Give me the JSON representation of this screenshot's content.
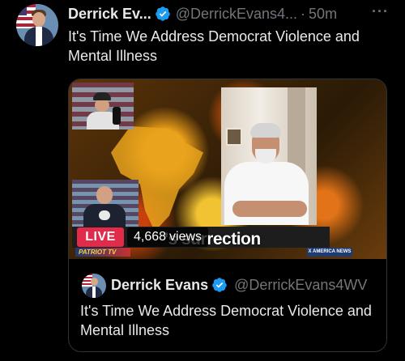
{
  "tweet": {
    "display_name": "Derrick Ev...",
    "handle": "@DerrickEvans4...",
    "separator": "·",
    "time": "50m",
    "more_label": "···",
    "text": "It's Time We Address Democrat Violence and Mental Illness"
  },
  "quote": {
    "display_name": "Derrick Evans",
    "handle": "@DerrickEvans4WV",
    "text": "It's Time We Address Democrat Violence and Mental Illness",
    "media": {
      "live_label": "LIVE",
      "views_count": "4,668",
      "views_label": "views",
      "overlay_title": "'s surrection",
      "brand_left": "PATRIOT TV",
      "brand_right": "X AMERICA NEWS"
    }
  },
  "colors": {
    "background": "#000000",
    "text_primary": "#e7e9ea",
    "text_secondary": "#71767b",
    "verified": "#1d9bf0",
    "live": "#e02b4a",
    "border": "#2f3336"
  },
  "icons": {
    "verified": "verified-badge-icon",
    "more": "more-options-icon"
  }
}
